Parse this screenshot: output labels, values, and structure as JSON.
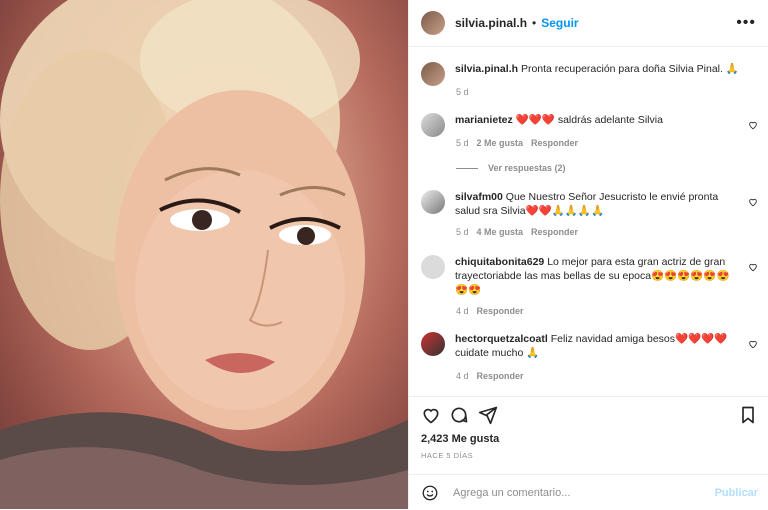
{
  "post": {
    "username": "silvia.pinal.h",
    "separator": "•",
    "follow_label": "Seguir",
    "more_label": "•••"
  },
  "caption": {
    "username": "silvia.pinal.h",
    "text": "Pronta recuperación para doña Silvia Pinal. 🙏",
    "time": "5 d"
  },
  "comments": [
    {
      "username": "marianietez",
      "text": "❤️❤️❤️ saldrás adelante Silvia",
      "time": "5 d",
      "likes": "2 Me gusta",
      "reply": "Responder",
      "view_replies": "Ver respuestas (2)"
    },
    {
      "username": "silvafm00",
      "text": "Que Nuestro Señor Jesucristo le envié pronta salud sra Silvia❤️❤️🙏🙏🙏🙏",
      "time": "5 d",
      "likes": "4 Me gusta",
      "reply": "Responder"
    },
    {
      "username": "chiquitabonita629",
      "text": "Lo mejor para esta gran actriz de gran trayectoriabde las mas bellas de su epoca😍😍😍😍😍😍😍😍",
      "time": "4 d",
      "reply": "Responder"
    },
    {
      "username": "hectorquetzalcoatl",
      "text": "Feliz navidad amiga besos❤️❤️❤️❤️ cuidate mucho 🙏",
      "time": "4 d",
      "reply": "Responder"
    }
  ],
  "footer": {
    "likes": "2,423 Me gusta",
    "ago": "HACE 5 DÍAS",
    "comment_placeholder": "Agrega un comentario...",
    "publish_label": "Publicar"
  },
  "icons": [
    "emoji-icon",
    "heart-icon",
    "comment-icon",
    "share-icon",
    "bookmark-icon",
    "more-icon"
  ]
}
